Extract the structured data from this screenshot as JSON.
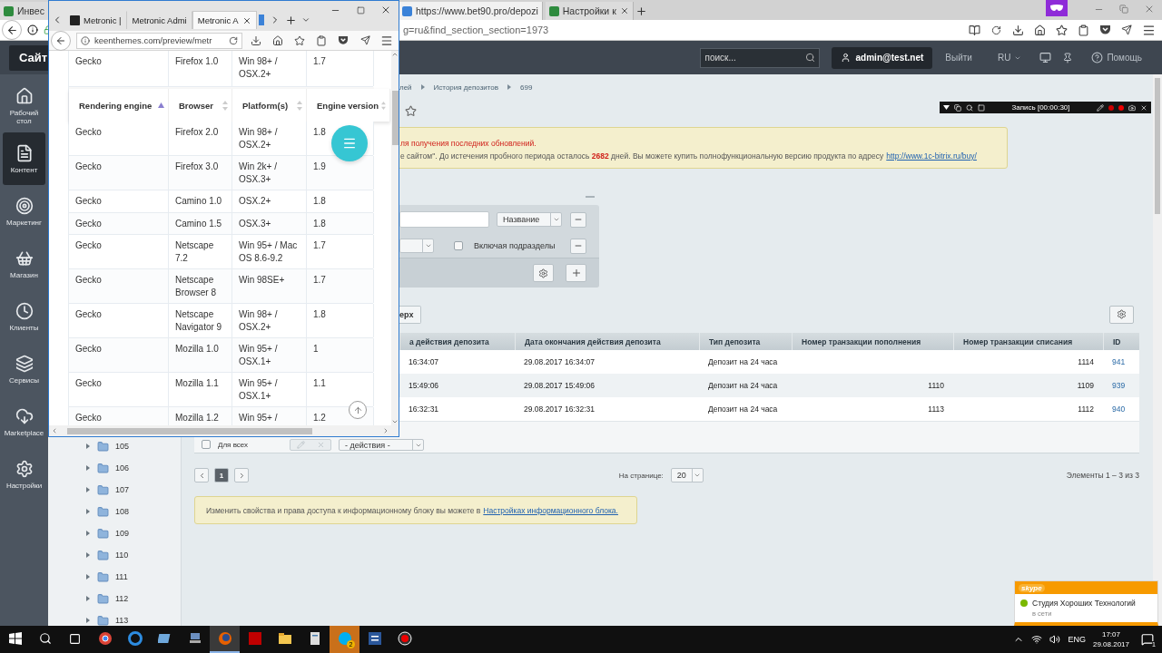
{
  "back_browser": {
    "tabs": [
      {
        "label": "Инвес",
        "selected": false
      },
      {
        "label": "https://www.bet90.pro/depozi",
        "selected": true
      },
      {
        "label": "Настройки к",
        "selected": false
      }
    ],
    "address": "g=ru&find_section_section=1973"
  },
  "admin_panel": {
    "site": "Сайт",
    "search_placeholder": "поиск...",
    "user": "admin@test.net",
    "logout": "Выйти",
    "language": "RU",
    "help": "Помощь"
  },
  "sidebar": {
    "items": [
      {
        "label": "Рабочий стол",
        "selected": false
      },
      {
        "label": "Контент",
        "selected": true
      },
      {
        "label": "Маркетинг",
        "selected": false
      },
      {
        "label": "Магазин",
        "selected": false
      },
      {
        "label": "Клиенты",
        "selected": false
      },
      {
        "label": "Сервисы",
        "selected": false
      },
      {
        "label": "Marketplace",
        "selected": false
      },
      {
        "label": "Настройки",
        "selected": false
      }
    ]
  },
  "tree": {
    "items": [
      {
        "label": "105",
        "expanded": false
      },
      {
        "label": "106",
        "expanded": false
      },
      {
        "label": "107",
        "expanded": false
      },
      {
        "label": "108",
        "expanded": false
      },
      {
        "label": "109",
        "expanded": false
      },
      {
        "label": "110",
        "expanded": false
      },
      {
        "label": "111",
        "expanded": false
      },
      {
        "label": "112",
        "expanded": false
      },
      {
        "label": "113",
        "expanded": false
      }
    ]
  },
  "breadcrumb": [
    "лей",
    "История депозитов",
    "699"
  ],
  "notice": {
    "warning": "ля получения последних обновлений.",
    "text": "е сайтом\". До истечения пробного периода осталось **2682** дней. Вы можете купить полнофункциональную версию продукта по адресу",
    "link": "http://www.1c-bitrix.ru/buy/"
  },
  "filter": {
    "option": "Название",
    "include_label": "Включая подразделы",
    "include_checked": false
  },
  "deposits": {
    "top_button": "ерх",
    "columns": [
      "а действия депозита",
      "Дата окончания действия депозита",
      "Тип депозита",
      "Номер транзакции пополнения",
      "Номер транзакции списания",
      "ID"
    ],
    "rows": [
      {
        "start": "16:34:07",
        "end": "29.08.2017 16:34:07",
        "type": "Депозит на 24 часа",
        "debit": "1114",
        "id": "941"
      },
      {
        "start": "15:49:06",
        "end": "29.08.2017 15:49:06",
        "type": "Депозит на 24 часа",
        "topup": "1110",
        "debit": "1109",
        "id": "939"
      },
      {
        "start": "16:32:31",
        "end": "29.08.2017 16:32:31",
        "type": "Депозит на 24 часа",
        "topup": "1113",
        "debit": "1112",
        "id": "940"
      }
    ],
    "select_all_label": "Для всех",
    "select_all_checked": false,
    "actions": "- действия -"
  },
  "pagination": {
    "pages": [
      {
        "label": "1",
        "selected": true
      }
    ],
    "per_page_label": "На странице:",
    "per_page": "20",
    "summary": "Элементы 1 – 3 из 3"
  },
  "info": {
    "text": "Изменить свойства и права доступа к информационному блоку вы можете в",
    "link": "Настройках информационного блока."
  },
  "metronic": {
    "tabs": [
      {
        "label": "Metronic |",
        "selected": false
      },
      {
        "label": "Metronic Admi",
        "selected": false
      },
      {
        "label": "Metronic A",
        "selected": true
      }
    ],
    "url": "keenthemes.com/preview/metr",
    "columns": [
      {
        "label": "Rendering engine",
        "sorted": true
      },
      {
        "label": "Browser",
        "sorted": false
      },
      {
        "label": "Platform(s)",
        "sorted": false
      },
      {
        "label": "Engine version",
        "sorted": false
      }
    ],
    "first_row": [
      "Gecko",
      "Firefox 1.0",
      "Win 98+ / OSX.2+",
      "1.7"
    ],
    "rows": [
      [
        "Gecko",
        "Firefox 2.0",
        "Win 98+ / OSX.2+",
        "1.8"
      ],
      [
        "Gecko",
        "Firefox 3.0",
        "Win 2k+ / OSX.3+",
        "1.9"
      ],
      [
        "Gecko",
        "Camino 1.0",
        "OSX.2+",
        "1.8"
      ],
      [
        "Gecko",
        "Camino 1.5",
        "OSX.3+",
        "1.8"
      ],
      [
        "Gecko",
        "Netscape 7.2",
        "Win 95+ / Mac OS 8.6-9.2",
        "1.7"
      ],
      [
        "Gecko",
        "Netscape Browser 8",
        "Win 98SE+",
        "1.7"
      ],
      [
        "Gecko",
        "Netscape Navigator 9",
        "Win 98+ / OSX.2+",
        "1.8"
      ],
      [
        "Gecko",
        "Mozilla 1.0",
        "Win 95+ / OSX.1+",
        "1"
      ],
      [
        "Gecko",
        "Mozilla 1.1",
        "Win 95+ / OSX.1+",
        "1.1"
      ],
      [
        "Gecko",
        "Mozilla 1.2",
        "Win 95+ /",
        "1.2"
      ]
    ]
  },
  "recorder": {
    "label": "Запись [00:00:30]"
  },
  "skype": {
    "logo": "skype",
    "contact": "Студия Хороших Технологий",
    "status": "в сети"
  },
  "taskbar": {
    "apps": [
      {
        "active": false,
        "attention": false
      },
      {
        "active": false,
        "attention": false
      },
      {
        "active": false,
        "attention": false
      },
      {
        "active": false,
        "attention": false
      },
      {
        "active": true,
        "attention": false
      },
      {
        "active": false,
        "attention": false
      },
      {
        "active": false,
        "attention": false
      },
      {
        "active": false,
        "attention": false
      },
      {
        "active": false,
        "attention": true,
        "badge": "2"
      },
      {
        "active": false,
        "attention": false
      },
      {
        "active": false,
        "attention": false
      }
    ],
    "language": "ENG",
    "time": "17:07",
    "date": "29.08.2017",
    "notifications": "1"
  }
}
